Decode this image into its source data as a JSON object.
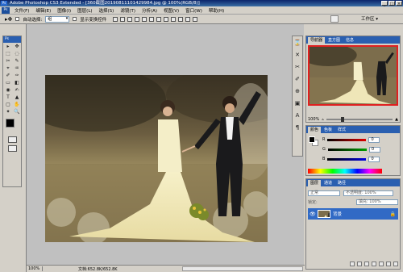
{
  "window": {
    "title": "Adobe Photoshop CS3 Extended - [360截图20190811101429984.jpg @ 100%(RGB/8)]",
    "app_badge": "Ps",
    "buttons": [
      "_",
      "□",
      "×"
    ]
  },
  "menu": {
    "items": [
      "文件(F)",
      "编辑(E)",
      "图像(I)",
      "图层(L)",
      "选择(S)",
      "滤镜(T)",
      "分析(A)",
      "视图(V)",
      "窗口(W)",
      "帮助(H)"
    ]
  },
  "options": {
    "auto_select_label": "自动选择:",
    "auto_select_value": "组",
    "show_transform_label": "显示变换控件",
    "workspace_label": "工作区 ▾"
  },
  "toolbox": {
    "header": "Ps",
    "tools": [
      "▸",
      "✥",
      "⬚",
      "◌",
      "✂",
      "✎",
      "⌖",
      "♒",
      "✐",
      "✑",
      "▭",
      "◧",
      "◉",
      "✍",
      "T",
      "▲",
      "▢",
      "✋",
      "✦",
      "🔍"
    ]
  },
  "document": {
    "zoom": "100%",
    "doc_info": "文档:652.8K/652.8K"
  },
  "navigator": {
    "tabs": [
      "导航器",
      "直方图",
      "信息"
    ],
    "zoom": "100%"
  },
  "color_panel": {
    "tabs": [
      "颜色",
      "色板",
      "样式"
    ],
    "channels": [
      {
        "label": "R",
        "value": "0",
        "color": "#e00000"
      },
      {
        "label": "G",
        "value": "0",
        "color": "#00a000"
      },
      {
        "label": "B",
        "value": "0",
        "color": "#0000e0"
      }
    ]
  },
  "layers_panel": {
    "tabs": [
      "图层",
      "通道",
      "路径"
    ],
    "blend_mode": "正常",
    "opacity": "不透明度: 100%",
    "fill": "填充: 100%",
    "lock_label": "锁定:",
    "layer_name": "背景"
  }
}
